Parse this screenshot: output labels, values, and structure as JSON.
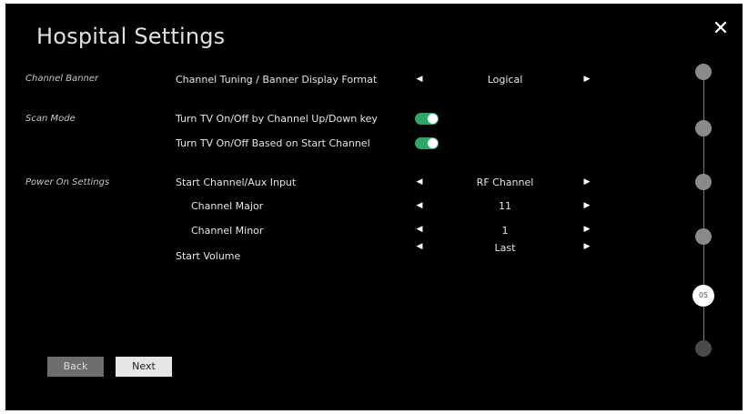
{
  "title": "Hospital Settings",
  "close_icon": "close-icon",
  "sections": {
    "channel_banner": "Channel Banner",
    "scan_mode": "Scan Mode",
    "power_on": "Power On Settings"
  },
  "settings": {
    "banner_format": {
      "label": "Channel Tuning / Banner Display Format",
      "value": "Logical"
    },
    "tv_onoff_updown": {
      "label": "Turn TV On/Off by Channel Up/Down key",
      "on": true
    },
    "tv_onoff_start": {
      "label": "Turn TV On/Off Based on Start Channel",
      "on": true
    },
    "start_channel": {
      "label": "Start Channel/Aux Input",
      "value": "RF Channel"
    },
    "channel_major": {
      "label": "Channel Major",
      "value": "11"
    },
    "channel_minor": {
      "label": "Channel Minor",
      "value": "1"
    },
    "start_volume": {
      "label": "Start Volume",
      "value": "Last"
    }
  },
  "stepper": {
    "current": "05"
  },
  "buttons": {
    "back": "Back",
    "next": "Next"
  },
  "colors": {
    "background": "#000000",
    "toggle_on": "#2ea86a",
    "step": "#8a8a8a"
  }
}
